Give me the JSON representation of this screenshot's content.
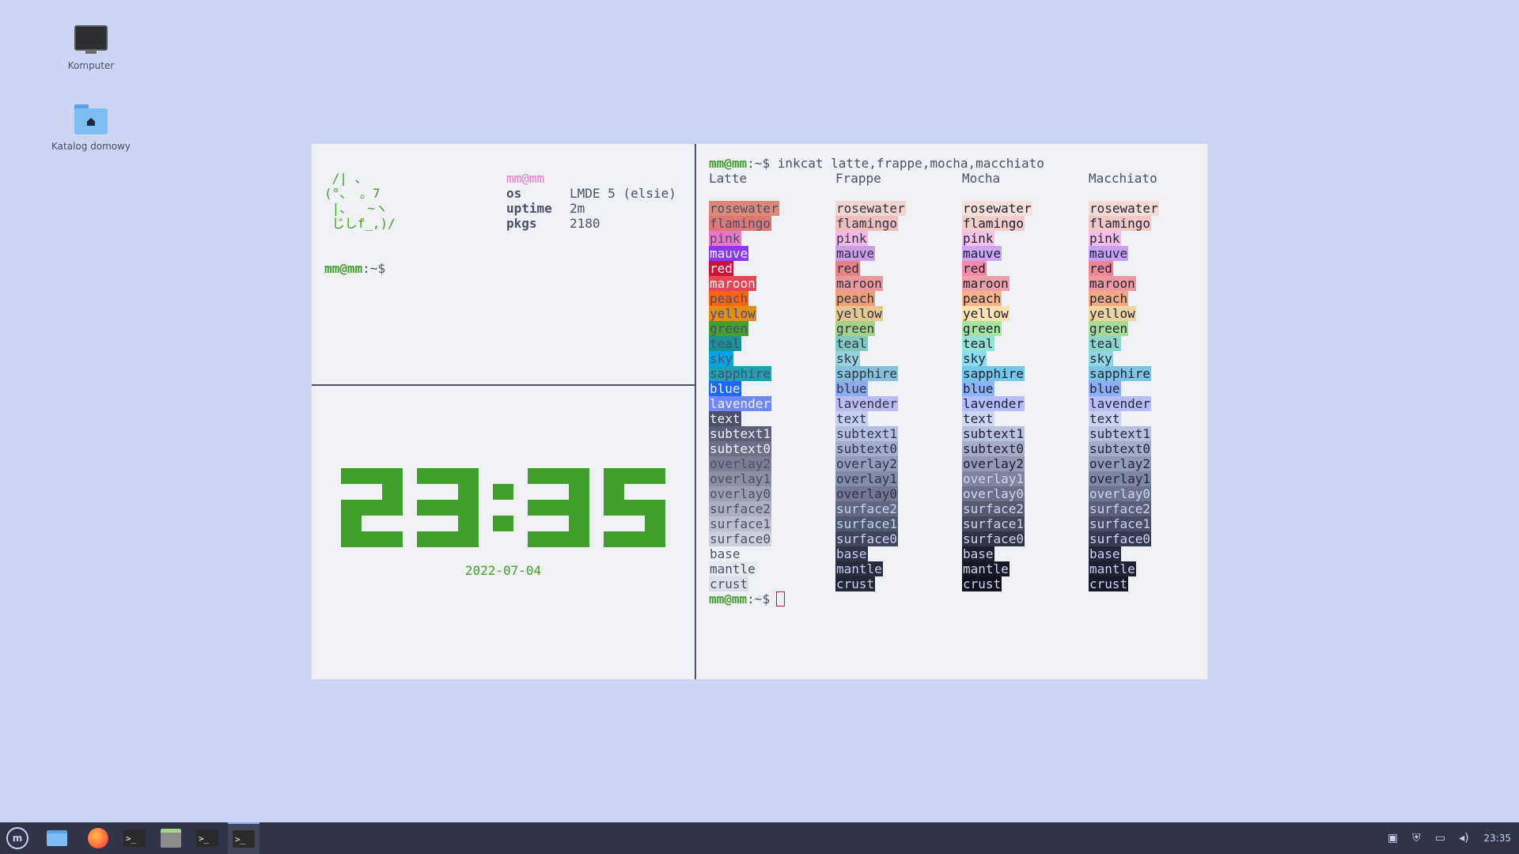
{
  "desktop": {
    "icons": [
      {
        "label": "Komputer",
        "icon": "computer-icon"
      },
      {
        "label": "Katalog domowy",
        "icon": "home-folder-icon"
      }
    ]
  },
  "left_top": {
    "ascii_art": " /| 、\n(°、 。7\n |、  ~ヽ\n じしf_,)/",
    "user_host": "mm@mm",
    "info": [
      {
        "key": "os",
        "value": "LMDE 5 (elsie)"
      },
      {
        "key": "uptime",
        "value": "2m"
      },
      {
        "key": "pkgs",
        "value": "2180"
      }
    ],
    "prompt_user": "mm@mm",
    "prompt_path": ":~$"
  },
  "clock": {
    "time": "23:35",
    "date": "2022-07-04",
    "color": "#40a02b"
  },
  "right": {
    "command_user": "mm@mm",
    "command_rest": ":~$ inkcat latte,frappe,mocha,macchiato",
    "names": [
      "rosewater",
      "flamingo",
      "pink",
      "mauve",
      "red",
      "maroon",
      "peach",
      "yellow",
      "green",
      "teal",
      "sky",
      "sapphire",
      "blue",
      "lavender",
      "text",
      "subtext1",
      "subtext0",
      "overlay2",
      "overlay1",
      "overlay0",
      "surface2",
      "surface1",
      "surface0",
      "base",
      "mantle",
      "crust"
    ],
    "flavors": [
      {
        "name": "Latte",
        "colors": [
          "#dc8a78",
          "#dd7878",
          "#ea76cb",
          "#8839ef",
          "#d20f39",
          "#e64553",
          "#fe640b",
          "#df8e1d",
          "#40a02b",
          "#179299",
          "#04a5e5",
          "#209fb5",
          "#1e66f5",
          "#7287fd",
          "#4c4f69",
          "#5c5f77",
          "#6c6f85",
          "#7c7f93",
          "#8c8fa1",
          "#9ca0b0",
          "#acb0be",
          "#bcc0cc",
          "#ccd0da",
          "#eff1f5",
          "#e6e9ef",
          "#dce0e8"
        ],
        "fg": [
          "#4c4f69",
          "#4c4f69",
          "#4c4f69",
          "#eff1f5",
          "#eff1f5",
          "#eff1f5",
          "#4c4f69",
          "#4c4f69",
          "#4c4f69",
          "#4c4f69",
          "#4c4f69",
          "#4c4f69",
          "#eff1f5",
          "#eff1f5",
          "#eff1f5",
          "#eff1f5",
          "#eff1f5",
          "#4c4f69",
          "#4c4f69",
          "#4c4f69",
          "#4c4f69",
          "#4c4f69",
          "#4c4f69",
          "#4c4f69",
          "#4c4f69",
          "#4c4f69"
        ]
      },
      {
        "name": "Frappe",
        "colors": [
          "#f2d5cf",
          "#eebebe",
          "#f4b8e4",
          "#ca9ee6",
          "#e78284",
          "#ea999c",
          "#ef9f76",
          "#e5c890",
          "#a6d189",
          "#81c8be",
          "#99d1db",
          "#85c1dc",
          "#8caaee",
          "#babbf1",
          "#c6d0f5",
          "#b5bfe2",
          "#a5adce",
          "#949cbb",
          "#838ba7",
          "#737994",
          "#626880",
          "#51576d",
          "#414559",
          "#303446",
          "#292c3c",
          "#232634"
        ],
        "fg": [
          "#303446",
          "#303446",
          "#303446",
          "#303446",
          "#303446",
          "#303446",
          "#303446",
          "#303446",
          "#303446",
          "#303446",
          "#303446",
          "#303446",
          "#303446",
          "#303446",
          "#303446",
          "#303446",
          "#303446",
          "#303446",
          "#303446",
          "#303446",
          "#c6d0f5",
          "#c6d0f5",
          "#c6d0f5",
          "#c6d0f5",
          "#c6d0f5",
          "#c6d0f5"
        ]
      },
      {
        "name": "Mocha",
        "colors": [
          "#f5e0dc",
          "#f2cdcd",
          "#f5c2e7",
          "#cba6f7",
          "#f38ba8",
          "#eba0ac",
          "#fab387",
          "#f9e2af",
          "#a6e3a1",
          "#94e2d5",
          "#89dceb",
          "#74c7ec",
          "#89b4fa",
          "#b4befe",
          "#cdd6f4",
          "#bac2de",
          "#a6adc8",
          "#9399b2",
          "#7f849c",
          "#6c7086",
          "#585b70",
          "#45475a",
          "#313244",
          "#1e1e2e",
          "#181825",
          "#11111b"
        ],
        "fg": [
          "#1e1e2e",
          "#1e1e2e",
          "#1e1e2e",
          "#1e1e2e",
          "#1e1e2e",
          "#1e1e2e",
          "#1e1e2e",
          "#1e1e2e",
          "#1e1e2e",
          "#1e1e2e",
          "#1e1e2e",
          "#1e1e2e",
          "#1e1e2e",
          "#1e1e2e",
          "#1e1e2e",
          "#1e1e2e",
          "#1e1e2e",
          "#1e1e2e",
          "#cdd6f4",
          "#cdd6f4",
          "#cdd6f4",
          "#cdd6f4",
          "#cdd6f4",
          "#cdd6f4",
          "#cdd6f4",
          "#cdd6f4"
        ]
      },
      {
        "name": "Macchiato",
        "colors": [
          "#f4dbd6",
          "#f0c6c6",
          "#f5bde6",
          "#c6a0f6",
          "#ed8796",
          "#ee99a0",
          "#f5a97f",
          "#eed49f",
          "#a6da95",
          "#8bd5ca",
          "#91d7e3",
          "#7dc4e4",
          "#8aadf4",
          "#b7bdf8",
          "#cad3f5",
          "#b8c0e0",
          "#a5adcb",
          "#939ab7",
          "#8087a2",
          "#6e738d",
          "#5b6078",
          "#494d64",
          "#363a4f",
          "#24273a",
          "#1e2030",
          "#181926"
        ],
        "fg": [
          "#24273a",
          "#24273a",
          "#24273a",
          "#24273a",
          "#24273a",
          "#24273a",
          "#24273a",
          "#24273a",
          "#24273a",
          "#24273a",
          "#24273a",
          "#24273a",
          "#24273a",
          "#24273a",
          "#24273a",
          "#24273a",
          "#24273a",
          "#24273a",
          "#24273a",
          "#cad3f5",
          "#cad3f5",
          "#cad3f5",
          "#cad3f5",
          "#cad3f5",
          "#cad3f5",
          "#cad3f5"
        ]
      }
    ],
    "prompt_user": "mm@mm",
    "prompt_path": ":~$"
  },
  "taskbar": {
    "apps": [
      "menu-icon",
      "files-icon",
      "firefox-icon",
      "terminal-icon",
      "file-manager-icon",
      "terminal-icon",
      "tmux-terminal-icon"
    ],
    "clock": "23:35",
    "tray": [
      "clipboard-icon",
      "shield-icon",
      "display-icon",
      "volume-icon"
    ]
  }
}
